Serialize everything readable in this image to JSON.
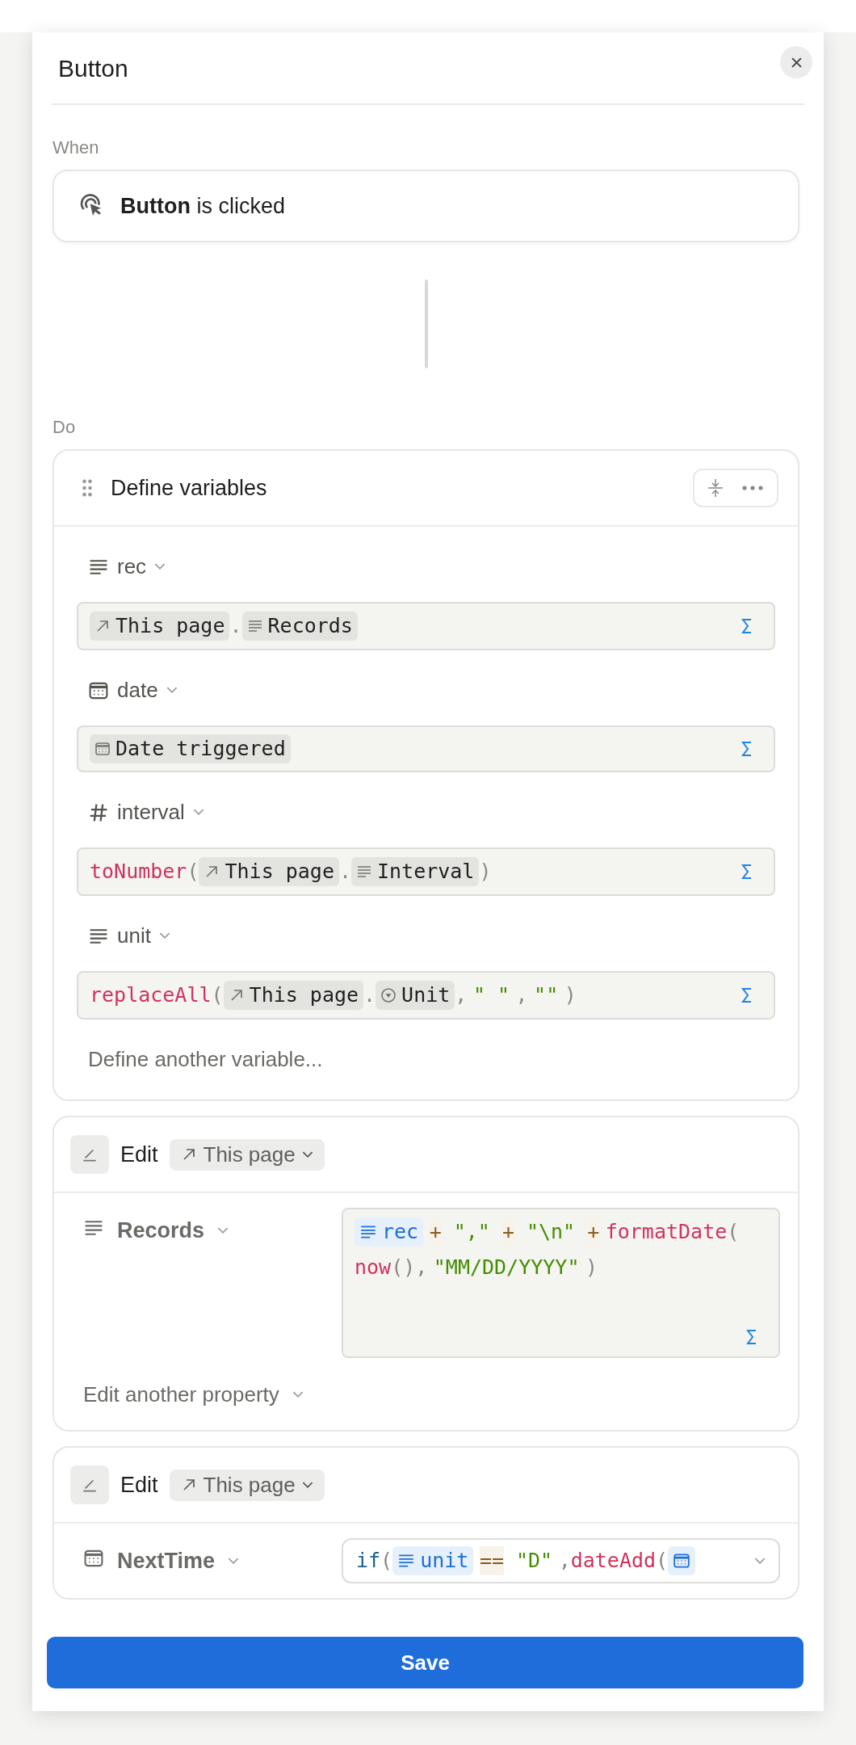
{
  "dialog": {
    "title": "Button"
  },
  "when": {
    "label": "When",
    "trigger": "**Button** is clicked"
  },
  "do": {
    "label": "Do"
  },
  "define_block": {
    "title": "Define variables",
    "variables": [
      {
        "name": "rec",
        "kind": "text",
        "tokens": [
          {
            "kind": "relation-ref",
            "text": "This page"
          },
          {
            "kind": "punct",
            "text": "."
          },
          {
            "kind": "text-ref",
            "text": "Records"
          }
        ]
      },
      {
        "name": "date",
        "kind": "date",
        "tokens": [
          {
            "kind": "date-ref",
            "text": "Date triggered"
          }
        ]
      },
      {
        "name": "interval",
        "kind": "number",
        "tokens": [
          {
            "kind": "fn",
            "text": "toNumber"
          },
          {
            "kind": "punct",
            "text": "("
          },
          {
            "kind": "relation-ref",
            "text": "This page"
          },
          {
            "kind": "punct",
            "text": "."
          },
          {
            "kind": "text-ref",
            "text": "Interval"
          },
          {
            "kind": "punct",
            "text": ")"
          }
        ]
      },
      {
        "name": "unit",
        "kind": "text",
        "tokens": [
          {
            "kind": "fn",
            "text": "replaceAll"
          },
          {
            "kind": "punct",
            "text": "("
          },
          {
            "kind": "relation-ref",
            "text": "This page"
          },
          {
            "kind": "punct",
            "text": "."
          },
          {
            "kind": "select-ref",
            "text": "Unit"
          },
          {
            "kind": "punct",
            "text": ","
          },
          {
            "kind": "str",
            "text": "\" \""
          },
          {
            "kind": "punct",
            "text": ","
          },
          {
            "kind": "str",
            "text": "\"\""
          },
          {
            "kind": "punct",
            "text": ")"
          }
        ]
      }
    ],
    "add_label": "Define another variable..."
  },
  "edit_blocks": [
    {
      "action": "Edit",
      "target": "This page",
      "properties": [
        {
          "name": "Records",
          "kind": "text",
          "expanded": true,
          "tokens": [
            {
              "kind": "text-var",
              "text": "rec"
            },
            {
              "kind": "op",
              "text": "+"
            },
            {
              "kind": "str",
              "text": "\",\""
            },
            {
              "kind": "op",
              "text": "+"
            },
            {
              "kind": "str",
              "text": "\"\\n\""
            },
            {
              "kind": "op",
              "text": "+"
            },
            {
              "kind": "fn",
              "text": "formatDate"
            },
            {
              "kind": "punct",
              "text": "("
            },
            {
              "kind": "fn",
              "text": "now"
            },
            {
              "kind": "punct",
              "text": "(),"
            },
            {
              "kind": "str",
              "text": "\"MM/DD/YYYY\""
            },
            {
              "kind": "punct",
              "text": ")"
            }
          ]
        }
      ],
      "add_label": "Edit another property"
    },
    {
      "action": "Edit",
      "target": "This page",
      "properties": [
        {
          "name": "NextTime",
          "kind": "date",
          "expanded": false,
          "tokens": [
            {
              "kind": "kw",
              "text": "if"
            },
            {
              "kind": "punct",
              "text": "("
            },
            {
              "kind": "text-var",
              "text": "unit"
            },
            {
              "kind": "op",
              "text": "=="
            },
            {
              "kind": "str",
              "text": "\"D\""
            },
            {
              "kind": "punct",
              "text": ","
            },
            {
              "kind": "fn",
              "text": "dateAdd"
            },
            {
              "kind": "punct",
              "text": "("
            },
            {
              "kind": "date-var"
            }
          ]
        }
      ]
    }
  ],
  "footer": {
    "save": "Save"
  }
}
